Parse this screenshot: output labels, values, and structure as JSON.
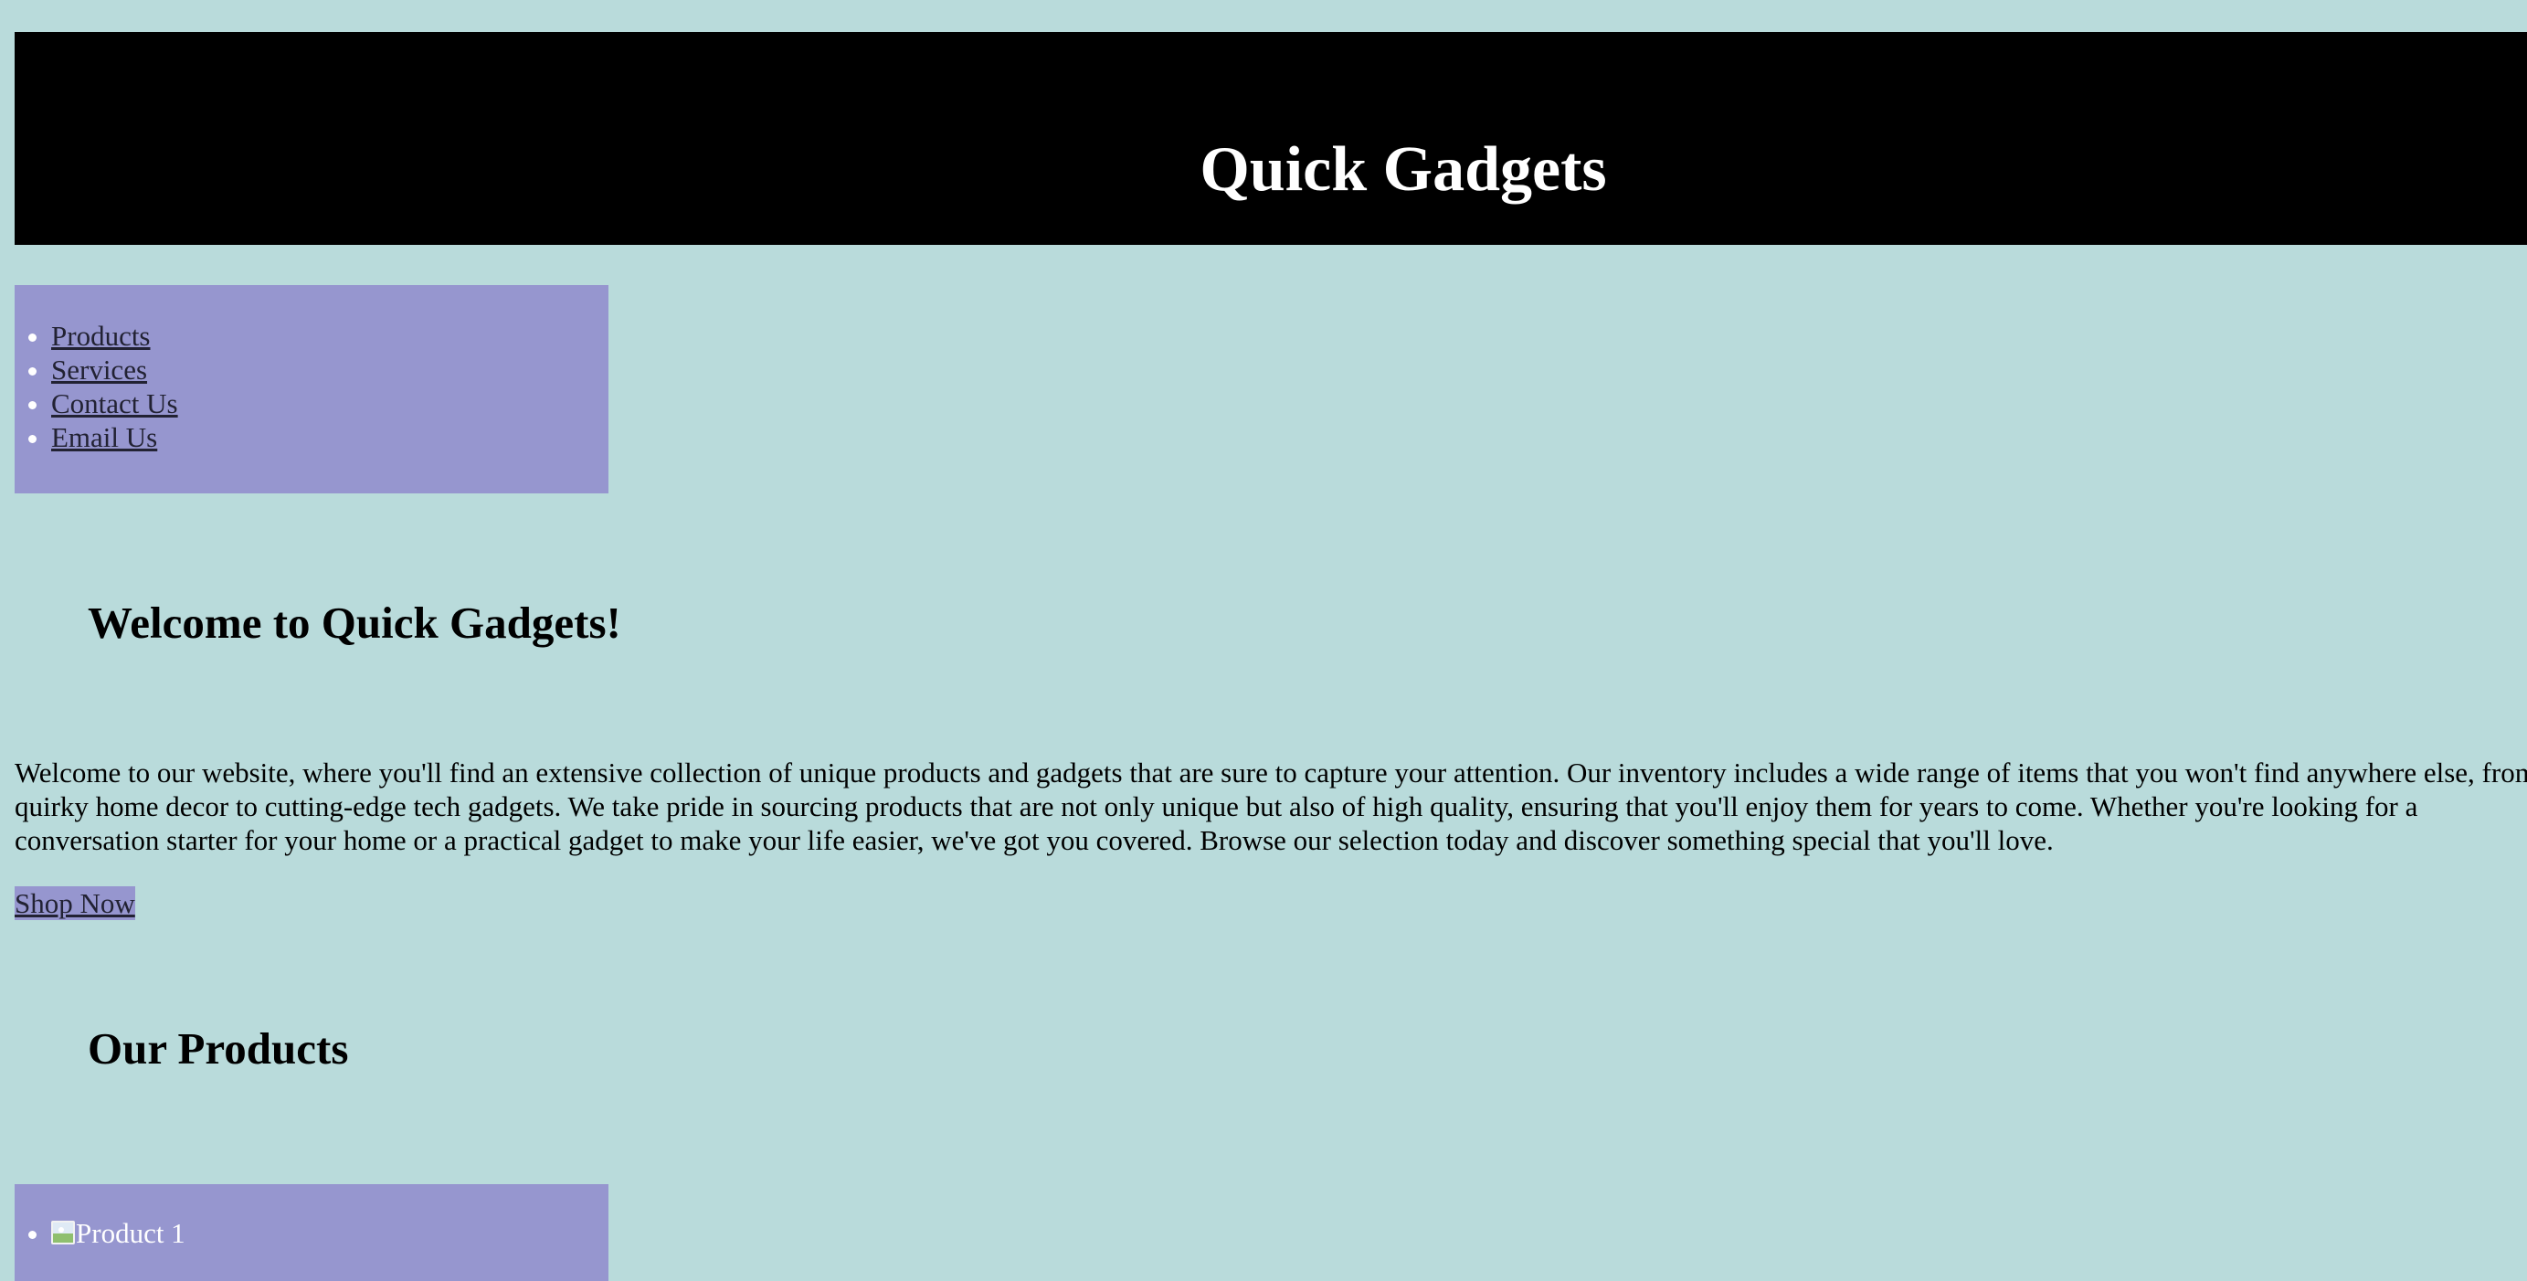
{
  "header": {
    "title": "Quick Gadgets"
  },
  "nav": {
    "items": [
      {
        "label": "Products"
      },
      {
        "label": "Services"
      },
      {
        "label": "Contact Us"
      },
      {
        "label": "Email Us"
      }
    ]
  },
  "welcome": {
    "heading": "Welcome to Quick Gadgets!",
    "text": "Welcome to our website, where you'll find an extensive collection of unique products and gadgets that are sure to capture your attention. Our inventory includes a wide range of items that you won't find anywhere else, from quirky home decor to cutting-edge tech gadgets. We take pride in sourcing products that are not only unique but also of high quality, ensuring that you'll enjoy them for years to come. Whether you're looking for a conversation starter for your home or a practical gadget to make your life easier, we've got you covered. Browse our selection today and discover something special that you'll love.",
    "cta_label": "Shop Now"
  },
  "products": {
    "heading": "Our Products",
    "items": [
      {
        "image_alt": "Product 1",
        "icon": "broken-image-icon"
      }
    ]
  },
  "colors": {
    "page_background": "#b9dbdb",
    "header_background": "#000000",
    "panel_background": "#9696cf",
    "link_text": "#222233"
  }
}
